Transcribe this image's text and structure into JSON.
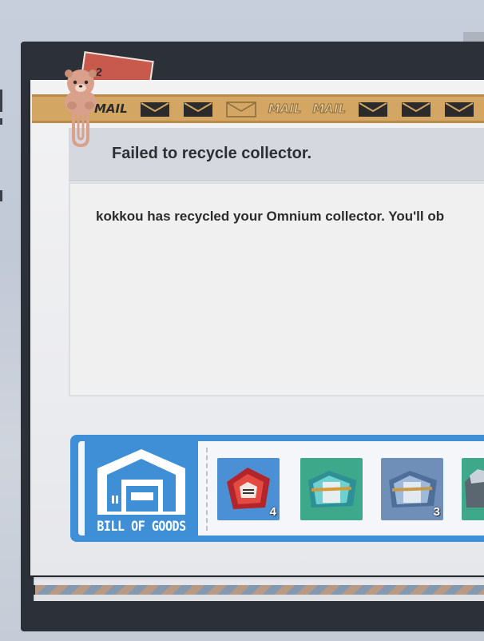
{
  "mail": {
    "tape_words": [
      "MAIL",
      "MAIL",
      "MAIL"
    ],
    "title": "Failed to recycle collector.",
    "message": "kokkou has recycled your Omnium collector. You'll ob",
    "stamp_number": "2"
  },
  "bill_of_goods": {
    "label": "BILL OF GOODS",
    "items": [
      {
        "name": "red-mask-item",
        "count": "4",
        "bg": "#4b8fd4"
      },
      {
        "name": "teal-crate-item",
        "count": "",
        "bg": "#3da88a"
      },
      {
        "name": "blue-crate-item",
        "count": "3",
        "bg": "#6f8fb9"
      },
      {
        "name": "partial-item",
        "count": "",
        "bg": "#3da88a"
      }
    ]
  },
  "colors": {
    "tape": "#d3a664",
    "bill_blue": "#3f8fd6",
    "title_text": "#2d2f33"
  }
}
